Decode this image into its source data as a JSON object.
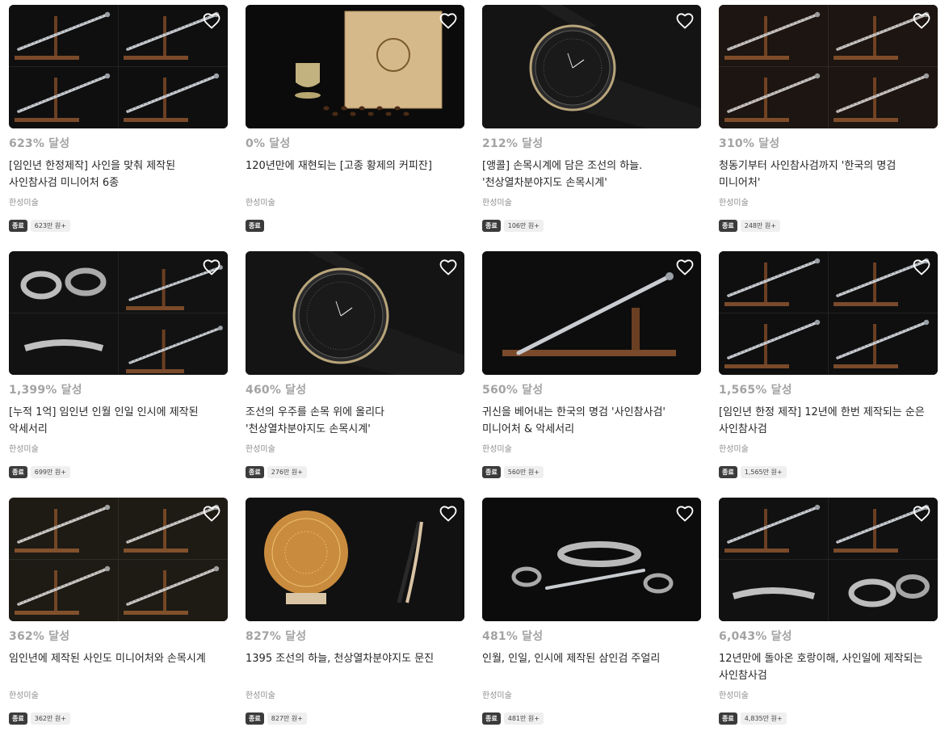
{
  "colors": {
    "status_badge_bg": "#3b3b3b",
    "percent_text": "#a3a3a3",
    "thumb_bg": "#121212"
  },
  "icons": {
    "like": "heart-outline-icon"
  },
  "cards": [
    {
      "art": "swords4",
      "percent": "623% 달성",
      "title": "[임인년 한정제작] 사인을 맞춰 제작된 사인참사검 미니어처 6종",
      "maker": "한성미술",
      "status": "종료",
      "amount": "623만 원+"
    },
    {
      "art": "tea",
      "percent": "0% 달성",
      "title": "120년만에 재현되는 [고종 황제의 커피잔]",
      "maker": "한성미술",
      "status": "종료",
      "amount": ""
    },
    {
      "art": "watch1",
      "percent": "212% 달성",
      "title": "[앵콜] 손목시계에 담은 조선의 하늘. '천상열차분야지도 손목시계'",
      "maker": "한성미술",
      "status": "종료",
      "amount": "106만 원+"
    },
    {
      "art": "swords4b",
      "percent": "310% 달성",
      "title": "청동기부터 사인참사검까지 '한국의 명검 미니어처'",
      "maker": "한성미술",
      "status": "종료",
      "amount": "248만 원+"
    },
    {
      "art": "bracelets",
      "percent": "1,399% 달성",
      "title": "[누적 1억] 임인년 인월 인일 인시에 제작된 악세서리",
      "maker": "한성미술",
      "status": "종료",
      "amount": "699만 원+"
    },
    {
      "art": "watch2",
      "percent": "460% 달성",
      "title": "조선의 우주를 손목 위에 올리다 '천상열차분야지도 손목시계'",
      "maker": "한성미술",
      "status": "종료",
      "amount": "276만 원+"
    },
    {
      "art": "sword1",
      "percent": "560% 달성",
      "title": "귀신을 베어내는 한국의 명검 '사인참사검' 미니어처 & 악세서리",
      "maker": "한성미술",
      "status": "종료",
      "amount": "560만 원+"
    },
    {
      "art": "swords4",
      "percent": "1,565% 달성",
      "title": "[임인년 한정 제작] 12년에 한번 제작되는 순은 사인참사검",
      "maker": "한성미술",
      "status": "종료",
      "amount": "1,565만 원+"
    },
    {
      "art": "swords4c",
      "percent": "362% 달성",
      "title": "임인년에 제작된 사인도 미니어처와 손목시계",
      "maker": "한성미술",
      "status": "종료",
      "amount": "362만 원+"
    },
    {
      "art": "plate",
      "percent": "827% 달성",
      "title": "1395 조선의 하늘, 천상열차분야지도 문진",
      "maker": "한성미술",
      "status": "종료",
      "amount": "827만 원+"
    },
    {
      "art": "jewel",
      "percent": "481% 달성",
      "title": "인월, 인일, 인시에 제작된 삼인검 주얼리",
      "maker": "한성미술",
      "status": "종료",
      "amount": "481만 원+"
    },
    {
      "art": "mix",
      "percent": "6,043% 달성",
      "title": "12년만에 돌아온 호랑이해, 사인일에 제작되는 사인참사검",
      "maker": "한성미술",
      "status": "종료",
      "amount": "4,835만 원+"
    }
  ]
}
